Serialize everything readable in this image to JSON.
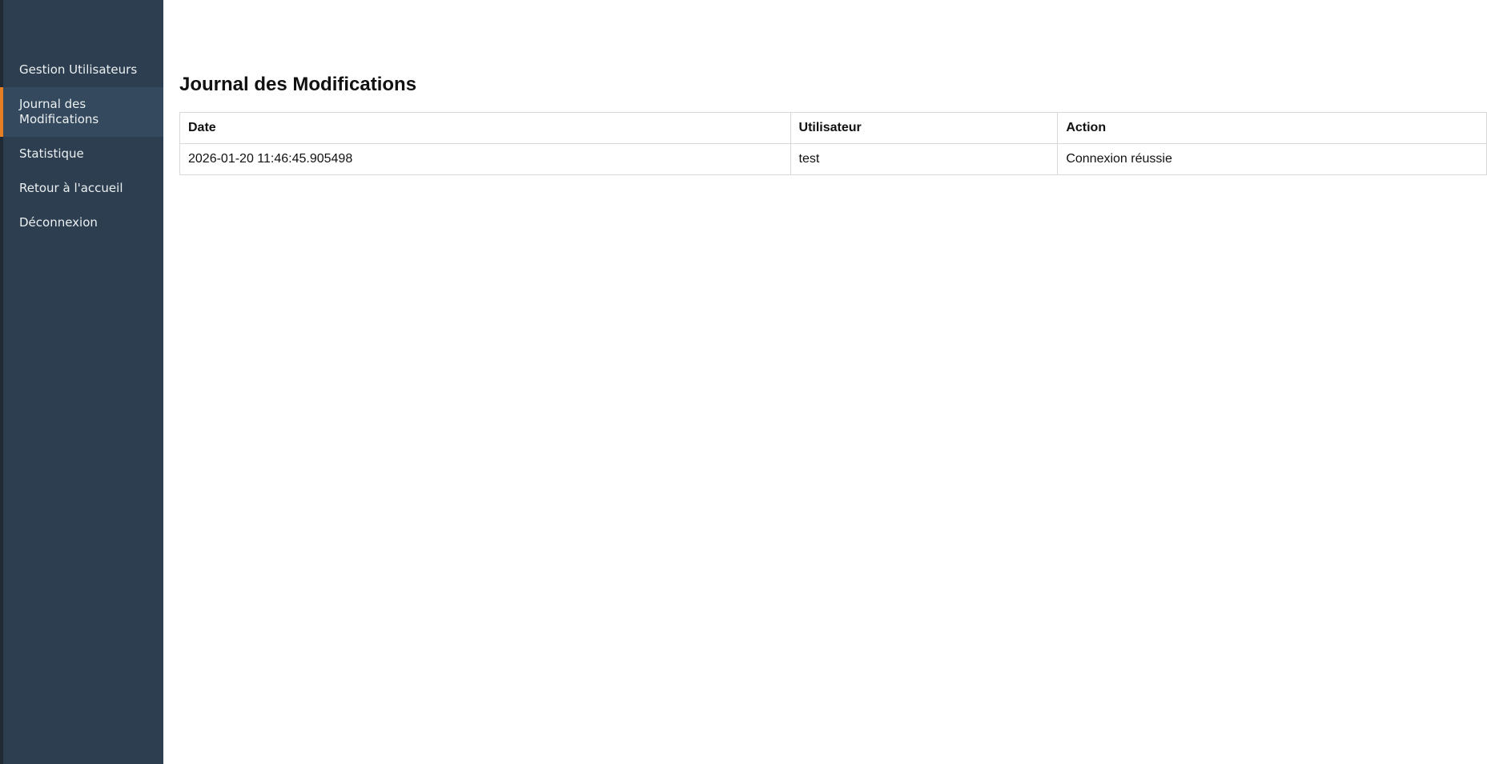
{
  "sidebar": {
    "items": [
      {
        "label": "Gestion Utilisateurs"
      },
      {
        "label": "Journal des Modifications"
      },
      {
        "label": "Statistique"
      },
      {
        "label": "Retour à l'accueil"
      },
      {
        "label": "Déconnexion"
      }
    ],
    "active_index": 1
  },
  "main": {
    "title": "Journal des Modifications",
    "table": {
      "headers": [
        "Date",
        "Utilisateur",
        "Action"
      ],
      "rows": [
        [
          "2026-01-20 11:46:45.905498",
          "test",
          "Connexion réussie"
        ]
      ]
    }
  },
  "colors": {
    "sidebar_bg": "#2c3e50",
    "sidebar_active_bg": "#34495e",
    "accent": "#e67e22"
  }
}
